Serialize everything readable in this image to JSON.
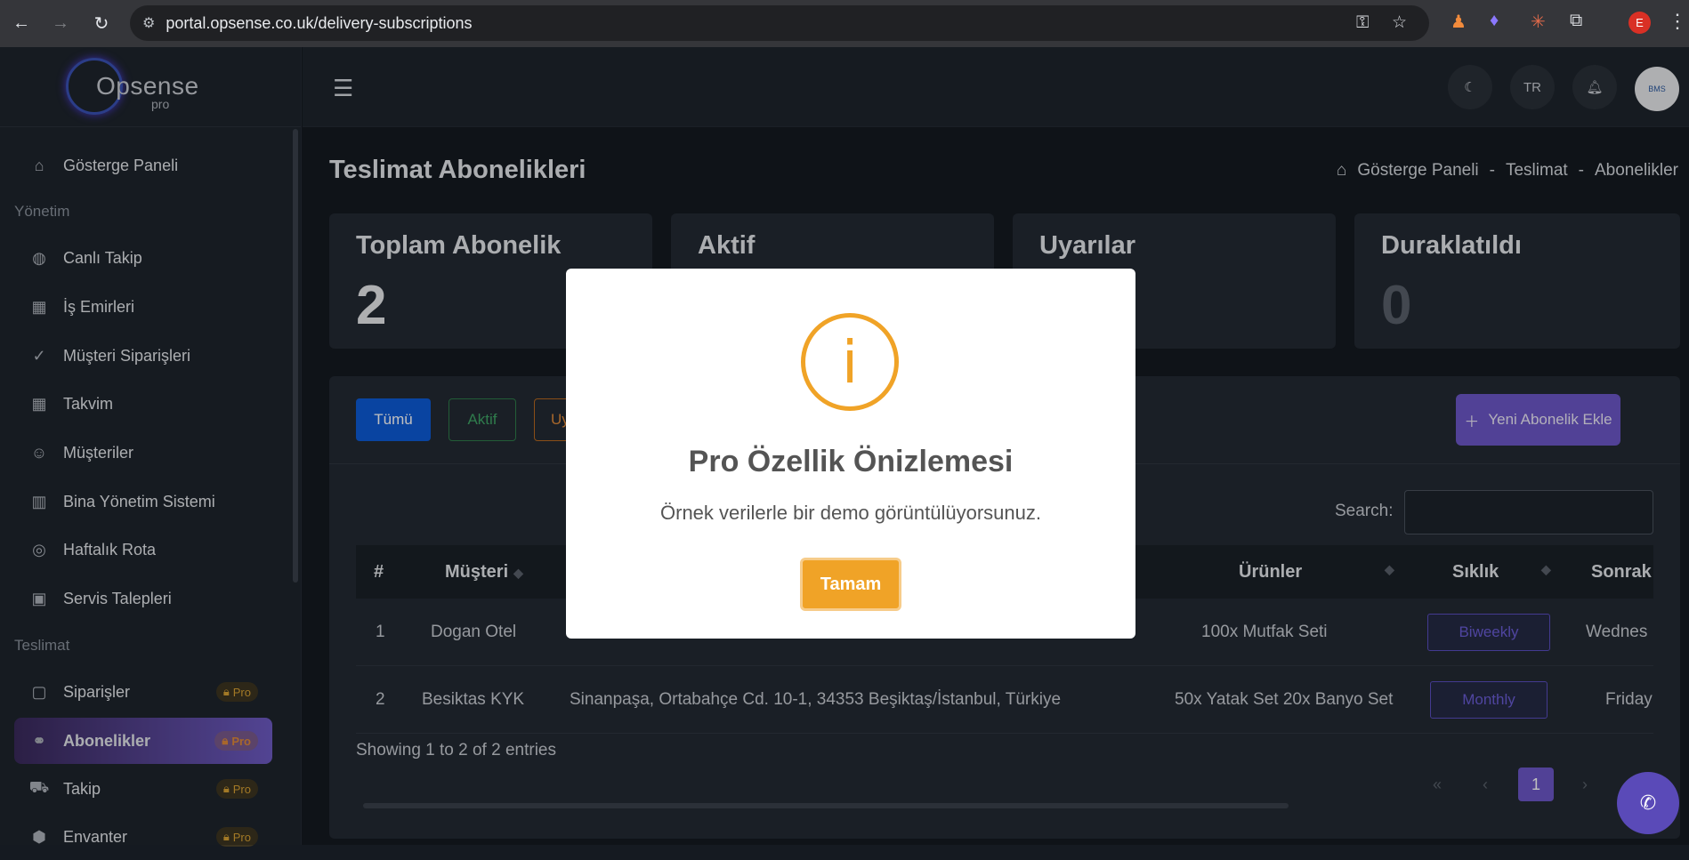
{
  "browser": {
    "url": "portal.opsense.co.uk/delivery-subscriptions",
    "profile_initial": "E"
  },
  "brand": {
    "logo_text": "Opsense",
    "logo_sub": "pro"
  },
  "sidebar": {
    "items": [
      {
        "label": "Gösterge Paneli",
        "icon": "dashboard-icon"
      },
      {
        "section": "Yönetim"
      },
      {
        "label": "Canlı Takip",
        "icon": "globe-icon"
      },
      {
        "label": "İş Emirleri",
        "icon": "calendar-icon"
      },
      {
        "label": "Müşteri Siparişleri",
        "icon": "check-circle-icon"
      },
      {
        "label": "Takvim",
        "icon": "calendar-icon"
      },
      {
        "label": "Müşteriler",
        "icon": "users-icon"
      },
      {
        "label": "Bina Yönetim Sistemi",
        "icon": "building-icon"
      },
      {
        "label": "Haftalık Rota",
        "icon": "compass-icon"
      },
      {
        "label": "Servis Talepleri",
        "icon": "ticket-icon"
      },
      {
        "section": "Teslimat"
      },
      {
        "label": "Siparişler",
        "icon": "bag-icon",
        "badge": "Pro"
      },
      {
        "label": "Abonelikler",
        "icon": "link-icon",
        "badge": "Pro",
        "active": true
      },
      {
        "label": "Takip",
        "icon": "truck-icon",
        "badge": "Pro"
      },
      {
        "label": "Envanter",
        "icon": "boxes-icon",
        "badge": "Pro"
      }
    ]
  },
  "topbar": {
    "lang": "TR",
    "avatar_text": "BMS"
  },
  "page": {
    "title": "Teslimat Abonelikleri",
    "breadcrumb": [
      "Gösterge Paneli",
      "-",
      "Teslimat",
      "-",
      "Abonelikler"
    ]
  },
  "stats": [
    {
      "label": "Toplam Abonelik",
      "value": "2"
    },
    {
      "label": "Aktif",
      "value": ""
    },
    {
      "label": "Uyarılar",
      "value": ""
    },
    {
      "label": "Duraklatıldı",
      "value": "0"
    }
  ],
  "filters": {
    "all": "Tümü",
    "active": "Aktif",
    "warn": "Uy"
  },
  "add_button": "Yeni Abonelik Ekle",
  "search_label": "Search:",
  "table": {
    "headers": [
      "#",
      "Müşteri",
      "Ürünler",
      "Sıklık",
      "Sonrak"
    ],
    "rows": [
      {
        "no": "1",
        "customer": "Dogan Otel",
        "address": "",
        "products": "100x Mutfak Seti",
        "freq": "Biweekly",
        "next": "Wednes"
      },
      {
        "no": "2",
        "customer": "Besiktas KYK",
        "address": "Sinanpaşa, Ortabahçe Cd. 10-1, 34353 Beşiktaş/İstanbul, Türkiye",
        "products": "50x Yatak Set 20x Banyo Set",
        "freq": "Monthly",
        "next": "Friday"
      }
    ],
    "entries": "Showing 1 to 2 of 2 entries",
    "page": "1"
  },
  "modal": {
    "title": "Pro Özellik Önizlemesi",
    "text": "Örnek verilerle bir demo görüntülüyorsunuz.",
    "ok": "Tamam",
    "icon_glyph": "i"
  }
}
